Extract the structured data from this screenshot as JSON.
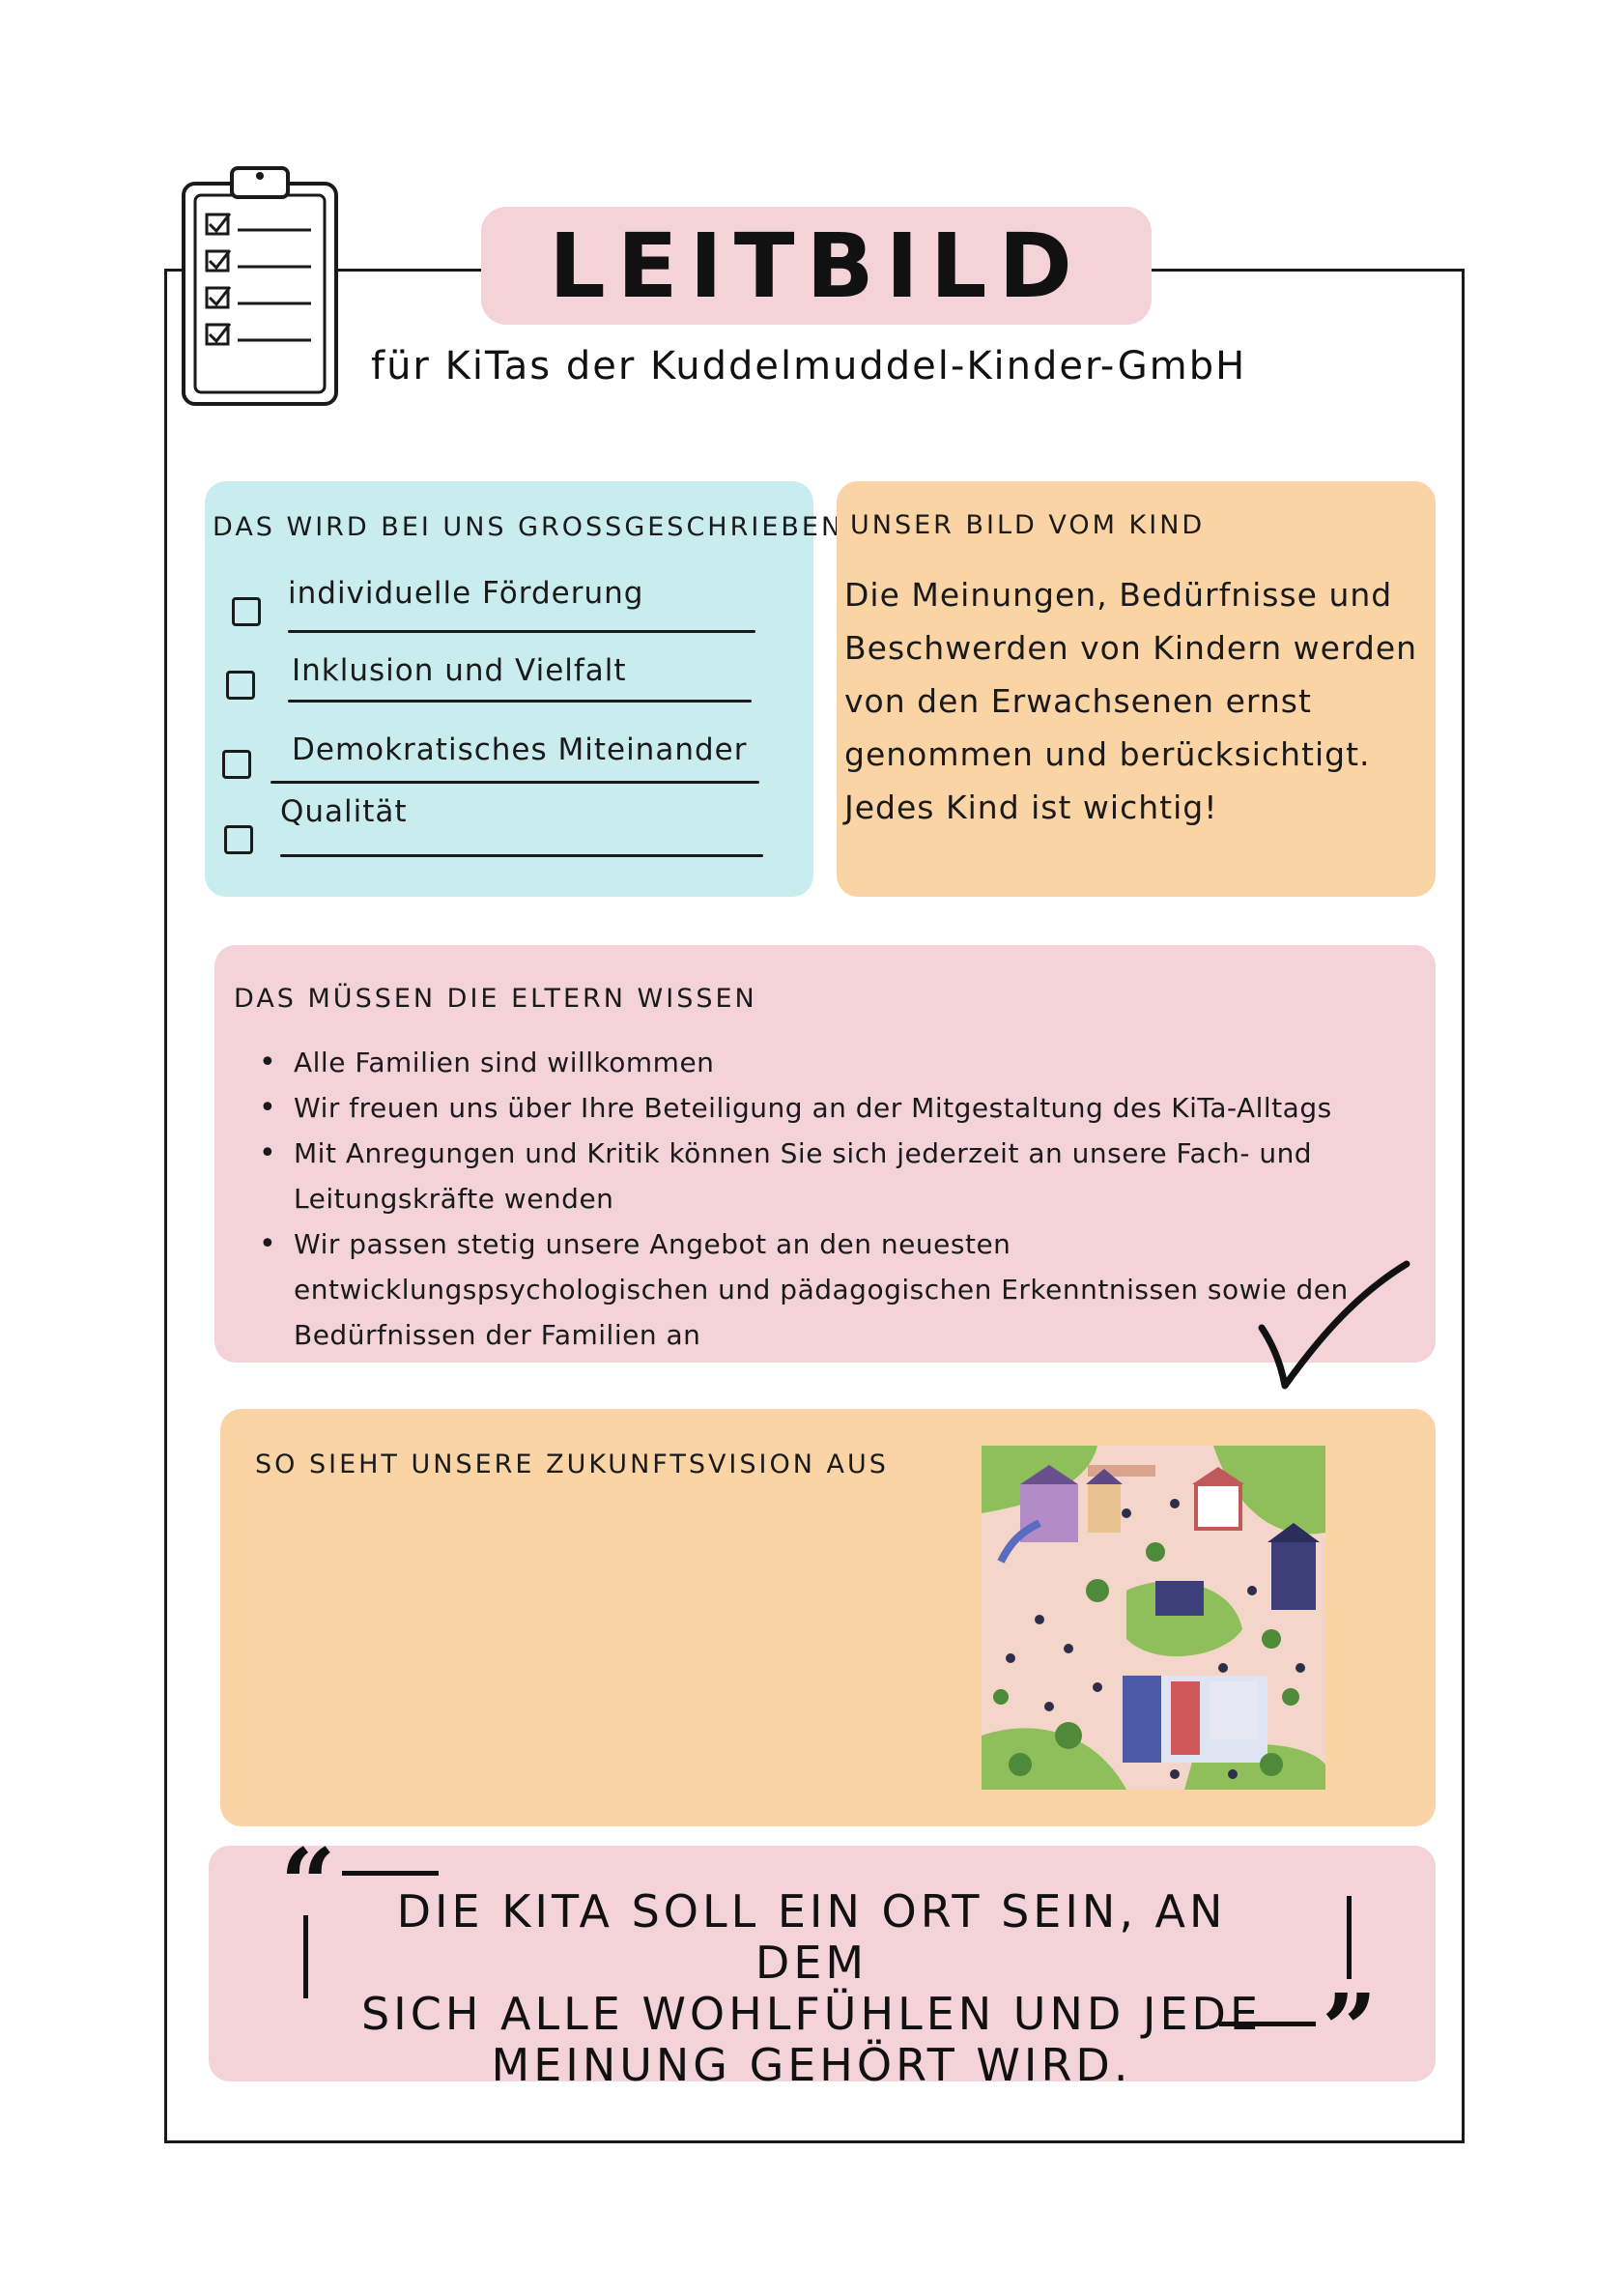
{
  "header": {
    "title": "LEITBILD",
    "subtitle": "für KiTas der Kuddelmuddel-Kinder-GmbH"
  },
  "values_box": {
    "heading": "DAS WIRD BEI UNS GROSSGESCHRIEBEN",
    "items": [
      "individuelle Förderung",
      "Inklusion und Vielfalt",
      "Demokratisches Miteinander",
      "Qualität"
    ]
  },
  "child_box": {
    "heading": "UNSER BILD VOM KIND",
    "lines": [
      "Die Meinungen, Bedürfnisse und",
      "Beschwerden von Kindern werden",
      "von den Erwachsenen ernst",
      "genommen und berücksichtigt.",
      "Jedes Kind ist wichtig!"
    ]
  },
  "parents_box": {
    "heading": "DAS MÜSSEN DIE ELTERN WISSEN",
    "bullets": [
      "Alle Familien sind willkommen",
      "Wir freuen uns über Ihre Beteiligung an der Mitgestaltung des KiTa-Alltags",
      "Mit Anregungen und Kritik können Sie sich jederzeit an unsere Fach- und Leitungskräfte wenden",
      "Wir passen stetig unsere Angebot an den neuesten entwicklungspsychologischen und pädagogischen Erkenntnissen sowie den Bedürfnissen der Familien an"
    ]
  },
  "vision_box": {
    "heading": "SO SIEHT UNSERE ZUKUNFTSVISION AUS"
  },
  "quote": {
    "lines": [
      "DIE KITA SOLL EIN ORT SEIN, AN DEM",
      "SICH ALLE WOHLFÜHLEN UND JEDE",
      "MEINUNG GEHÖRT WIRD."
    ]
  },
  "colors": {
    "pink": "#f3d3d8",
    "blue": "#c9ecef",
    "orange": "#fbd4a6",
    "ink": "#1a1a1a"
  },
  "icons": [
    "clipboard-checklist-icon",
    "checkmark-icon",
    "open-quote-icon",
    "close-quote-icon",
    "city-park-illustration"
  ]
}
